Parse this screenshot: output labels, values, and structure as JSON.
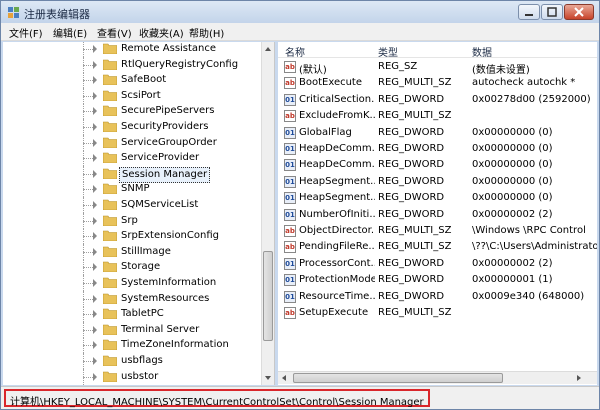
{
  "window": {
    "title": "注册表编辑器"
  },
  "menu": [
    "文件(F)",
    "编辑(E)",
    "查看(V)",
    "收藏夹(A)",
    "帮助(H)"
  ],
  "tree": {
    "items": [
      {
        "label": "Remote Assistance",
        "selected": false
      },
      {
        "label": "RtlQueryRegistryConfig",
        "selected": false
      },
      {
        "label": "SafeBoot",
        "selected": false
      },
      {
        "label": "ScsiPort",
        "selected": false
      },
      {
        "label": "SecurePipeServers",
        "selected": false
      },
      {
        "label": "SecurityProviders",
        "selected": false
      },
      {
        "label": "ServiceGroupOrder",
        "selected": false
      },
      {
        "label": "ServiceProvider",
        "selected": false
      },
      {
        "label": "Session Manager",
        "selected": true
      },
      {
        "label": "SNMP",
        "selected": false
      },
      {
        "label": "SQMServiceList",
        "selected": false
      },
      {
        "label": "Srp",
        "selected": false
      },
      {
        "label": "SrpExtensionConfig",
        "selected": false
      },
      {
        "label": "StillImage",
        "selected": false
      },
      {
        "label": "Storage",
        "selected": false
      },
      {
        "label": "SystemInformation",
        "selected": false
      },
      {
        "label": "SystemResources",
        "selected": false
      },
      {
        "label": "TabletPC",
        "selected": false
      },
      {
        "label": "Terminal Server",
        "selected": false
      },
      {
        "label": "TimeZoneInformation",
        "selected": false
      },
      {
        "label": "usbflags",
        "selected": false
      },
      {
        "label": "usbstor",
        "selected": false
      }
    ]
  },
  "list": {
    "columns": [
      "名称",
      "类型",
      "数据"
    ],
    "rows": [
      {
        "name": "(默认)",
        "type": "REG_SZ",
        "data": "(数值未设置)",
        "icon": "string-value-icon"
      },
      {
        "name": "BootExecute",
        "type": "REG_MULTI_SZ",
        "data": "autocheck autochk *",
        "icon": "string-value-icon"
      },
      {
        "name": "CriticalSection...",
        "type": "REG_DWORD",
        "data": "0x00278d00 (2592000)",
        "icon": "binary-value-icon"
      },
      {
        "name": "ExcludeFromK...",
        "type": "REG_MULTI_SZ",
        "data": "",
        "icon": "string-value-icon"
      },
      {
        "name": "GlobalFlag",
        "type": "REG_DWORD",
        "data": "0x00000000 (0)",
        "icon": "binary-value-icon"
      },
      {
        "name": "HeapDeComm...",
        "type": "REG_DWORD",
        "data": "0x00000000 (0)",
        "icon": "binary-value-icon"
      },
      {
        "name": "HeapDeComm...",
        "type": "REG_DWORD",
        "data": "0x00000000 (0)",
        "icon": "binary-value-icon"
      },
      {
        "name": "HeapSegment...",
        "type": "REG_DWORD",
        "data": "0x00000000 (0)",
        "icon": "binary-value-icon"
      },
      {
        "name": "HeapSegment...",
        "type": "REG_DWORD",
        "data": "0x00000000 (0)",
        "icon": "binary-value-icon"
      },
      {
        "name": "NumberOfIniti...",
        "type": "REG_DWORD",
        "data": "0x00000002 (2)",
        "icon": "binary-value-icon"
      },
      {
        "name": "ObjectDirector...",
        "type": "REG_MULTI_SZ",
        "data": "\\Windows \\RPC Control",
        "icon": "string-value-icon"
      },
      {
        "name": "PendingFileRe...",
        "type": "REG_MULTI_SZ",
        "data": "\\??\\C:\\Users\\Administrator",
        "icon": "string-value-icon"
      },
      {
        "name": "ProcessorCont...",
        "type": "REG_DWORD",
        "data": "0x00000002 (2)",
        "icon": "binary-value-icon"
      },
      {
        "name": "ProtectionMode",
        "type": "REG_DWORD",
        "data": "0x00000001 (1)",
        "icon": "binary-value-icon"
      },
      {
        "name": "ResourceTime...",
        "type": "REG_DWORD",
        "data": "0x0009e340 (648000)",
        "icon": "binary-value-icon"
      },
      {
        "name": "SetupExecute",
        "type": "REG_MULTI_SZ",
        "data": "",
        "icon": "string-value-icon"
      }
    ]
  },
  "status": {
    "path": "计算机\\HKEY_LOCAL_MACHINE\\SYSTEM\\CurrentControlSet\\Control\\Session Manager"
  },
  "colors": {
    "selection_border": "#d9262b",
    "folder": "#e8c25a"
  }
}
